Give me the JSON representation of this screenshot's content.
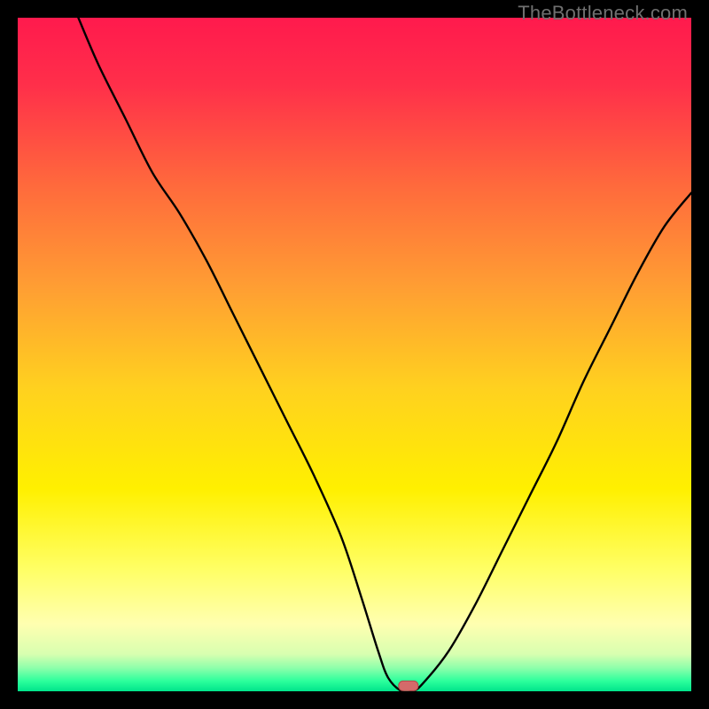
{
  "watermark": "TheBottleneck.com",
  "colors": {
    "frame": "#000000",
    "curve": "#000000",
    "marker_fill": "#d46a6a",
    "marker_stroke": "#b34a4a",
    "gradient_stops": [
      {
        "offset": 0.0,
        "color": "#ff1a4d"
      },
      {
        "offset": 0.1,
        "color": "#ff2f4a"
      },
      {
        "offset": 0.25,
        "color": "#ff6a3c"
      },
      {
        "offset": 0.4,
        "color": "#ff9e33"
      },
      {
        "offset": 0.55,
        "color": "#ffd11f"
      },
      {
        "offset": 0.7,
        "color": "#fff000"
      },
      {
        "offset": 0.82,
        "color": "#ffff66"
      },
      {
        "offset": 0.9,
        "color": "#ffffb0"
      },
      {
        "offset": 0.945,
        "color": "#d8ffb0"
      },
      {
        "offset": 0.965,
        "color": "#8fffab"
      },
      {
        "offset": 0.985,
        "color": "#2bff9c"
      },
      {
        "offset": 1.0,
        "color": "#00e48b"
      }
    ]
  },
  "chart_data": {
    "type": "line",
    "title": "",
    "xlabel": "",
    "ylabel": "",
    "xlim": [
      0,
      100
    ],
    "ylim": [
      0,
      100
    ],
    "grid": false,
    "legend": false,
    "series": [
      {
        "name": "bottleneck-curve",
        "x": [
          9,
          12,
          16,
          20,
          24,
          28,
          32,
          36,
          40,
          44,
          48,
          51,
          53.5,
          55,
          57,
          58.5,
          60,
          64,
          68,
          72,
          76,
          80,
          84,
          88,
          92,
          96,
          100
        ],
        "y": [
          100,
          93,
          85,
          77,
          71,
          64,
          56,
          48,
          40,
          32,
          23,
          14,
          6,
          2,
          0,
          0,
          1,
          6,
          13,
          21,
          29,
          37,
          46,
          54,
          62,
          69,
          74
        ]
      }
    ],
    "marker": {
      "x": 58,
      "y": 0.8,
      "shape": "pill"
    },
    "annotations": []
  }
}
